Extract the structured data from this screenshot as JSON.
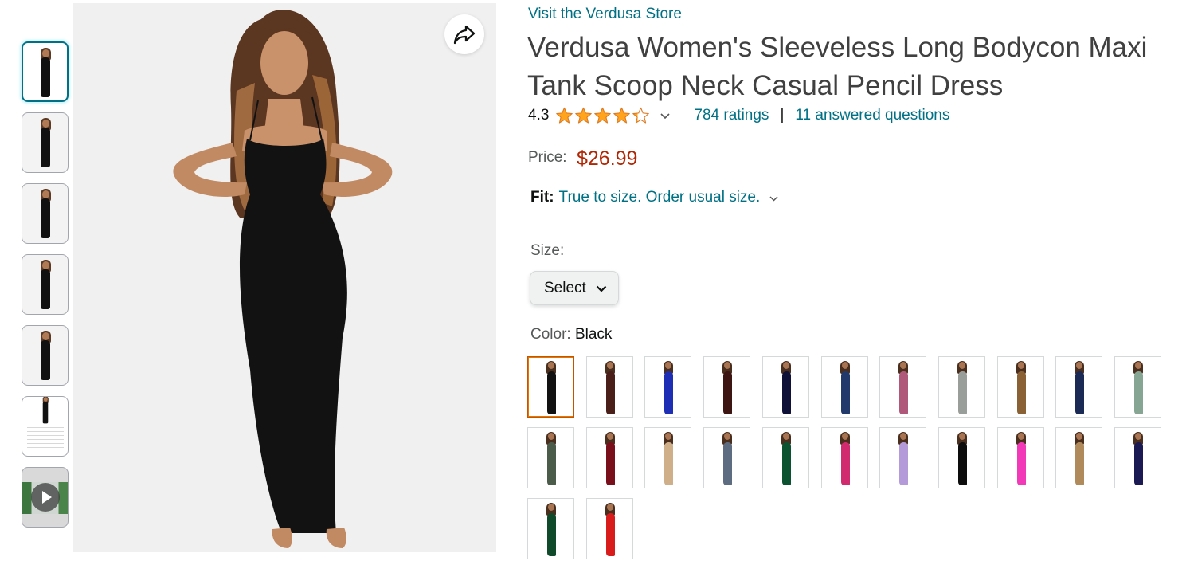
{
  "store": {
    "link_text": "Visit the Verdusa Store"
  },
  "product": {
    "title": "Verdusa Women's Sleeveless Long Bodycon Maxi Tank Scoop Neck Casual Pencil Dress",
    "rating_value": "4.3",
    "rating_stars": 4.3,
    "ratings_count": "784 ratings",
    "separator": "|",
    "answered_questions": "11 answered questions"
  },
  "price": {
    "label": "Price:",
    "value": "$26.99"
  },
  "fit": {
    "label": "Fit:",
    "text": "True to size. Order usual size."
  },
  "size": {
    "label": "Size:",
    "selected": "Select"
  },
  "color": {
    "label": "Color:",
    "selected": "Black",
    "swatch_colors": [
      "#111111",
      "#4a1f1a",
      "#1f2fb5",
      "#3d1512",
      "#0f1236",
      "#223a6b",
      "#b0587a",
      "#9a9e9a",
      "#8a6035",
      "#1b2a55",
      "#86a593",
      "#4c5c4a",
      "#7a0f1c",
      "#cfae8a",
      "#5d6c80",
      "#0c5230",
      "#d22a6e",
      "#b49ad8",
      "#0d0d0d",
      "#f23ab9",
      "#b08a5a",
      "#1c1a52",
      "#0f4a2a",
      "#d81c1c"
    ]
  },
  "thumbnails": [
    {
      "kind": "photo",
      "selected": true
    },
    {
      "kind": "photo",
      "selected": false
    },
    {
      "kind": "photo",
      "selected": false
    },
    {
      "kind": "photo",
      "selected": false
    },
    {
      "kind": "photo",
      "selected": false
    },
    {
      "kind": "size-chart",
      "selected": false
    },
    {
      "kind": "video",
      "selected": false
    }
  ],
  "icons": {
    "share": "share-icon",
    "play": "play-icon",
    "chevron": "chevron-down-icon",
    "star": "star-icon"
  }
}
